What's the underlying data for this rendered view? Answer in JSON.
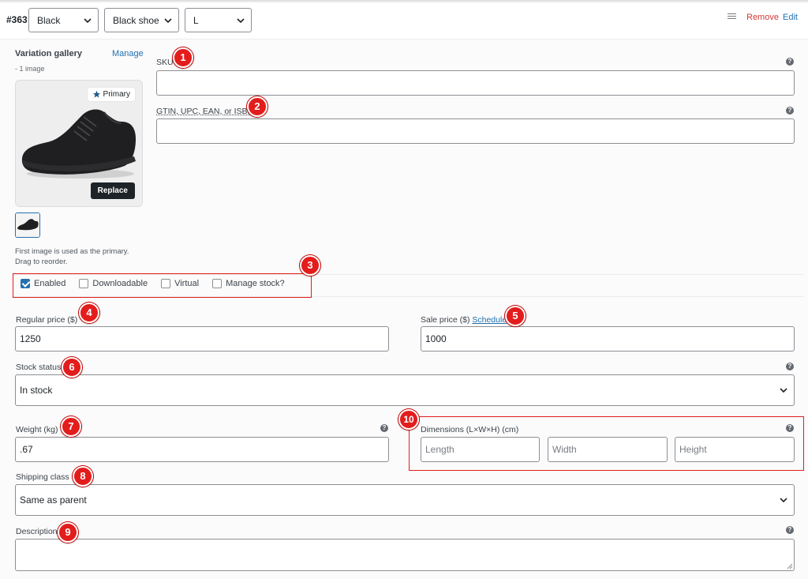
{
  "header": {
    "variation_id": "#363",
    "attributes": [
      {
        "selected": "Black"
      },
      {
        "selected": "Black shoe"
      },
      {
        "selected": "L"
      }
    ],
    "remove_label": "Remove",
    "edit_label": "Edit"
  },
  "gallery": {
    "title": "Variation gallery",
    "manage_label": "Manage",
    "count": "- 1 image",
    "primary_label": "Primary",
    "replace_label": "Replace",
    "hint_line1": "First image is used as the primary.",
    "hint_line2": "Drag to reorder."
  },
  "fields": {
    "sku": {
      "label": "SKU",
      "value": ""
    },
    "gtin": {
      "label": "GTIN, UPC, EAN, or ISBN",
      "value": ""
    },
    "regular_price": {
      "label": "Regular price ($)",
      "value": "1250"
    },
    "sale_price": {
      "label": "Sale price ($)",
      "schedule_label": "Schedule",
      "value": "1000"
    },
    "stock_status": {
      "label": "Stock status",
      "value": "In stock"
    },
    "weight": {
      "label": "Weight (kg)",
      "value": ".67"
    },
    "dimensions": {
      "label": "Dimensions (L×W×H) (cm)",
      "length_placeholder": "Length",
      "width_placeholder": "Width",
      "height_placeholder": "Height"
    },
    "shipping_class": {
      "label": "Shipping class",
      "value": "Same as parent"
    },
    "description": {
      "label": "Description",
      "value": ""
    }
  },
  "options": [
    {
      "label": "Enabled",
      "checked": true
    },
    {
      "label": "Downloadable",
      "checked": false
    },
    {
      "label": "Virtual",
      "checked": false
    },
    {
      "label": "Manage stock?",
      "checked": false
    }
  ],
  "callouts": [
    "1",
    "2",
    "3",
    "4",
    "5",
    "6",
    "7",
    "8",
    "9",
    "10"
  ],
  "colors": {
    "accent": "#2271b1",
    "danger": "#d63638",
    "callout": "#e31c1c"
  }
}
